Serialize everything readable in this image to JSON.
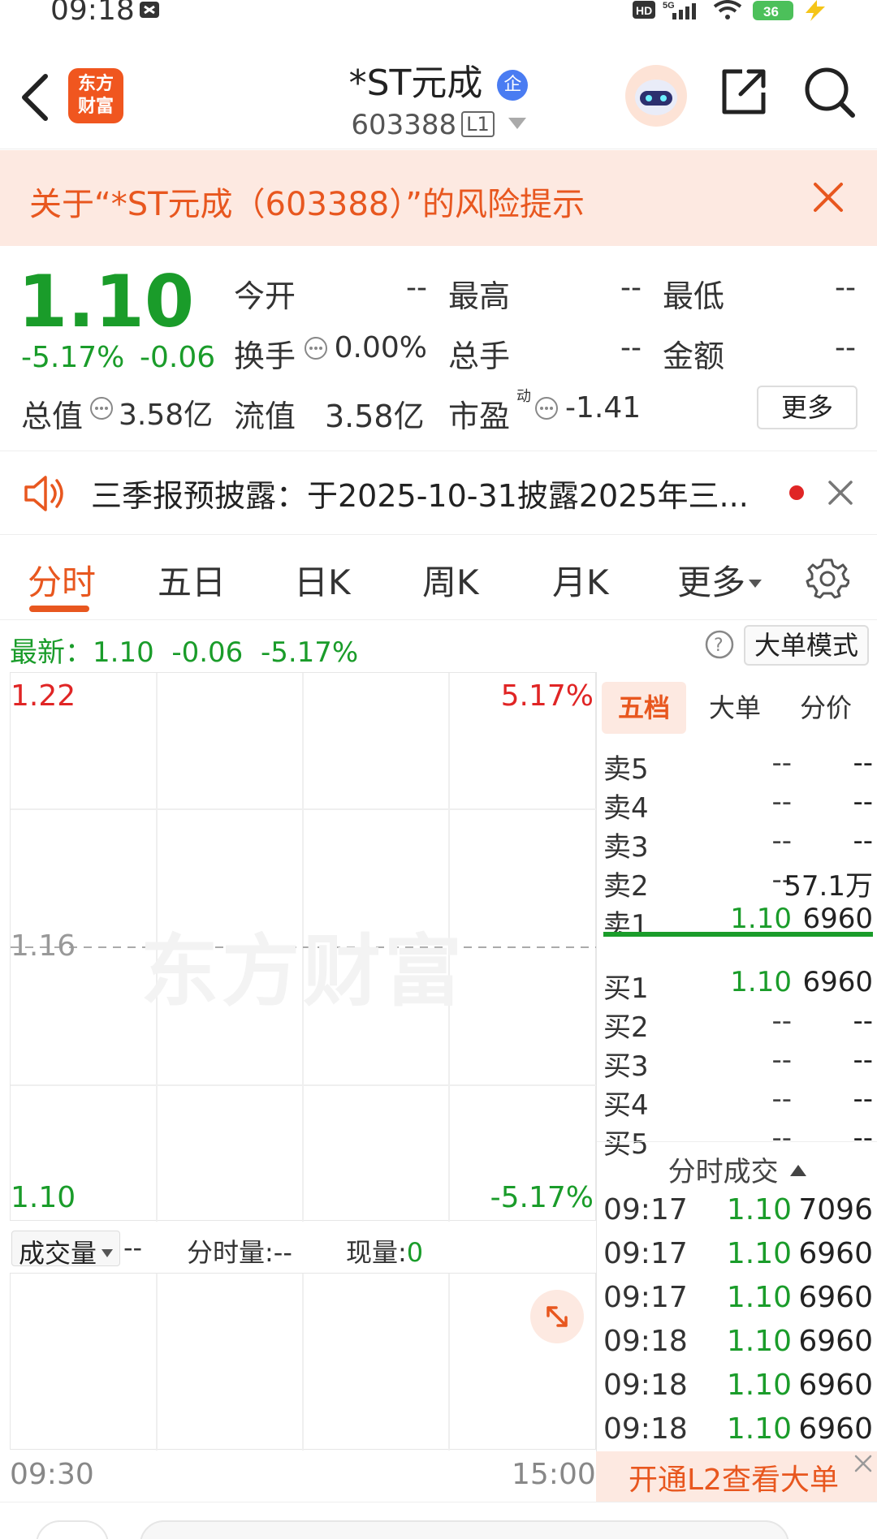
{
  "status_bar": {
    "time": "09:18",
    "battery": "36"
  },
  "header": {
    "title": "*ST元成",
    "badge": "企",
    "code": "603388",
    "level": "L1",
    "logo_line1": "东方",
    "logo_line2": "财富"
  },
  "risk_banner": {
    "text": "关于“*ST元成（603388）”的风险提示"
  },
  "quote": {
    "price": "1.10",
    "change_pct": "-5.17%",
    "change": "-0.06",
    "open_label": "今开",
    "open_value": "--",
    "high_label": "最高",
    "high_value": "--",
    "low_label": "最低",
    "low_value": "--",
    "turnover_label": "换手",
    "turnover_value": "0.00%",
    "volume_label": "总手",
    "volume_value": "--",
    "amount_label": "金额",
    "amount_value": "--",
    "mktcap_label": "总值",
    "mktcap_value": "3.58亿",
    "float_label": "流值",
    "float_value": "3.58亿",
    "pe_label": "市盈",
    "pe_sup": "动",
    "pe_value": "-1.41",
    "more_button": "更多"
  },
  "notice": {
    "text": "三季报预披露：于2025-10-31披露2025年三..."
  },
  "tabs": [
    "分时",
    "五日",
    "日K",
    "周K",
    "月K",
    "更多"
  ],
  "latest": {
    "label": "最新：",
    "price": "1.10",
    "change": "-0.06",
    "pct": "-5.17%",
    "big_order_mode": "大单模式"
  },
  "chart": {
    "y_top": "1.22",
    "y_mid": "1.16",
    "y_bottom": "1.10",
    "pct_top": "5.17%",
    "pct_bottom": "-5.17%",
    "watermark": "东方财富",
    "x_start": "09:30",
    "x_end": "15:00"
  },
  "volume_bar": {
    "selector": "成交量",
    "selector_value": "--",
    "minute_vol_label": "分时量:",
    "minute_vol_value": "--",
    "current_vol_label": "现量:",
    "current_vol_value": "0"
  },
  "order_book": {
    "tabs": [
      "五档",
      "大单",
      "分价"
    ],
    "asks": [
      {
        "label": "卖5",
        "price": "--",
        "vol": "--"
      },
      {
        "label": "卖4",
        "price": "--",
        "vol": "--"
      },
      {
        "label": "卖3",
        "price": "--",
        "vol": "--"
      },
      {
        "label": "卖2",
        "price": "--",
        "vol": "57.1万"
      },
      {
        "label": "卖1",
        "price": "1.10",
        "vol": "6960"
      }
    ],
    "bids": [
      {
        "label": "买1",
        "price": "1.10",
        "vol": "6960"
      },
      {
        "label": "买2",
        "price": "--",
        "vol": "--"
      },
      {
        "label": "买3",
        "price": "--",
        "vol": "--"
      },
      {
        "label": "买4",
        "price": "--",
        "vol": "--"
      },
      {
        "label": "买5",
        "price": "--",
        "vol": "--"
      }
    ],
    "ticks_header": "分时成交",
    "ticks": [
      {
        "time": "09:17",
        "price": "1.10",
        "vol": "7096"
      },
      {
        "time": "09:17",
        "price": "1.10",
        "vol": "6960"
      },
      {
        "time": "09:17",
        "price": "1.10",
        "vol": "6960"
      },
      {
        "time": "09:18",
        "price": "1.10",
        "vol": "6960"
      },
      {
        "time": "09:18",
        "price": "1.10",
        "vol": "6960"
      },
      {
        "time": "09:18",
        "price": "1.10",
        "vol": "6960"
      }
    ],
    "l2_banner": "开通L2查看大单"
  },
  "colors": {
    "accent": "#e8571f",
    "up": "#e02525",
    "down": "#1a9c2a"
  }
}
